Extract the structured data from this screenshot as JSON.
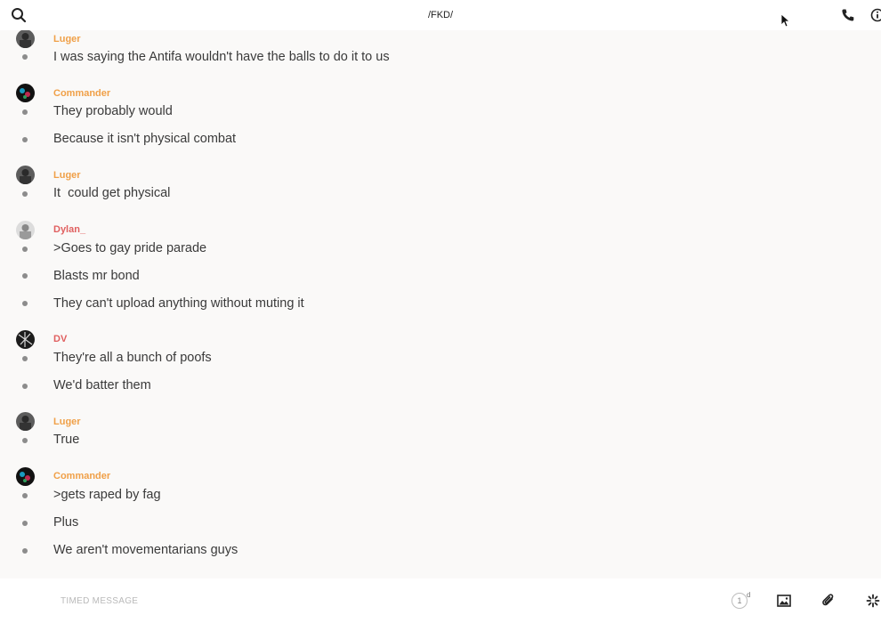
{
  "header": {
    "title": "/FKD/",
    "icons": [
      "search-icon",
      "phone-icon",
      "info-icon",
      "cursor-icon"
    ]
  },
  "colors": {
    "sender_orange": "#f0a048",
    "sender_red": "#e06060",
    "dot": "#8c8c8c",
    "text": "#3a3a3a"
  },
  "messages": [
    {
      "sender": "Luger",
      "texts": [
        "I was saying the Antifa wouldn't have the balls to do it to us"
      ]
    },
    {
      "sender": "Commander",
      "texts": [
        "They probably would",
        "Because it isn't physical combat"
      ]
    },
    {
      "sender": "Luger",
      "texts": [
        "It  could get physical"
      ]
    },
    {
      "sender": "Dylan_",
      "texts": [
        ">Goes to gay pride parade",
        "Blasts mr bond",
        "They can't upload anything without muting it"
      ]
    },
    {
      "sender": "DV",
      "texts": [
        "They're all a bunch of poofs",
        "We'd batter them"
      ]
    },
    {
      "sender": "Luger",
      "texts": [
        "True"
      ]
    },
    {
      "sender": "Commander",
      "texts": [
        ">gets raped by fag",
        "Plus",
        "We aren't movementarians guys"
      ]
    }
  ],
  "composer": {
    "placeholder": "TIMED MESSAGE",
    "timer_value": "1",
    "timer_unit": "d",
    "icons": [
      "timer-icon",
      "image-icon",
      "attachment-icon",
      "sparkle-icon"
    ]
  }
}
